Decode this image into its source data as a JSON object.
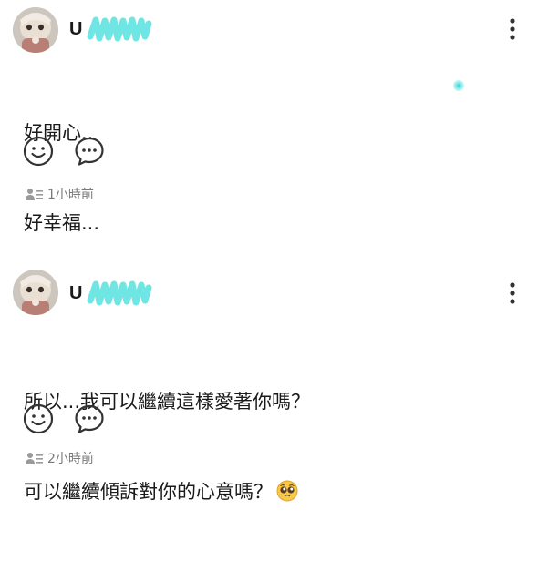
{
  "posts": [
    {
      "author": "U",
      "content_lines": [
        "好開心..",
        "好幸福..."
      ],
      "time": "1小時前"
    },
    {
      "author": "U",
      "content_lines": [
        "所以...我可以繼續這樣愛著你嗎？",
        "可以繼續傾訴對你的心意嗎？"
      ],
      "emoji": "pleading-face-emoji",
      "time": "2小時前"
    }
  ],
  "icons": {
    "more": "vertical-dots-icon",
    "react": "smiley-icon",
    "comment": "chat-bubble-icon",
    "audience": "people-list-icon"
  },
  "colors": {
    "redaction": "#5fe3e0",
    "meta_text": "#7a7a7a",
    "icon_stroke": "#333333"
  }
}
